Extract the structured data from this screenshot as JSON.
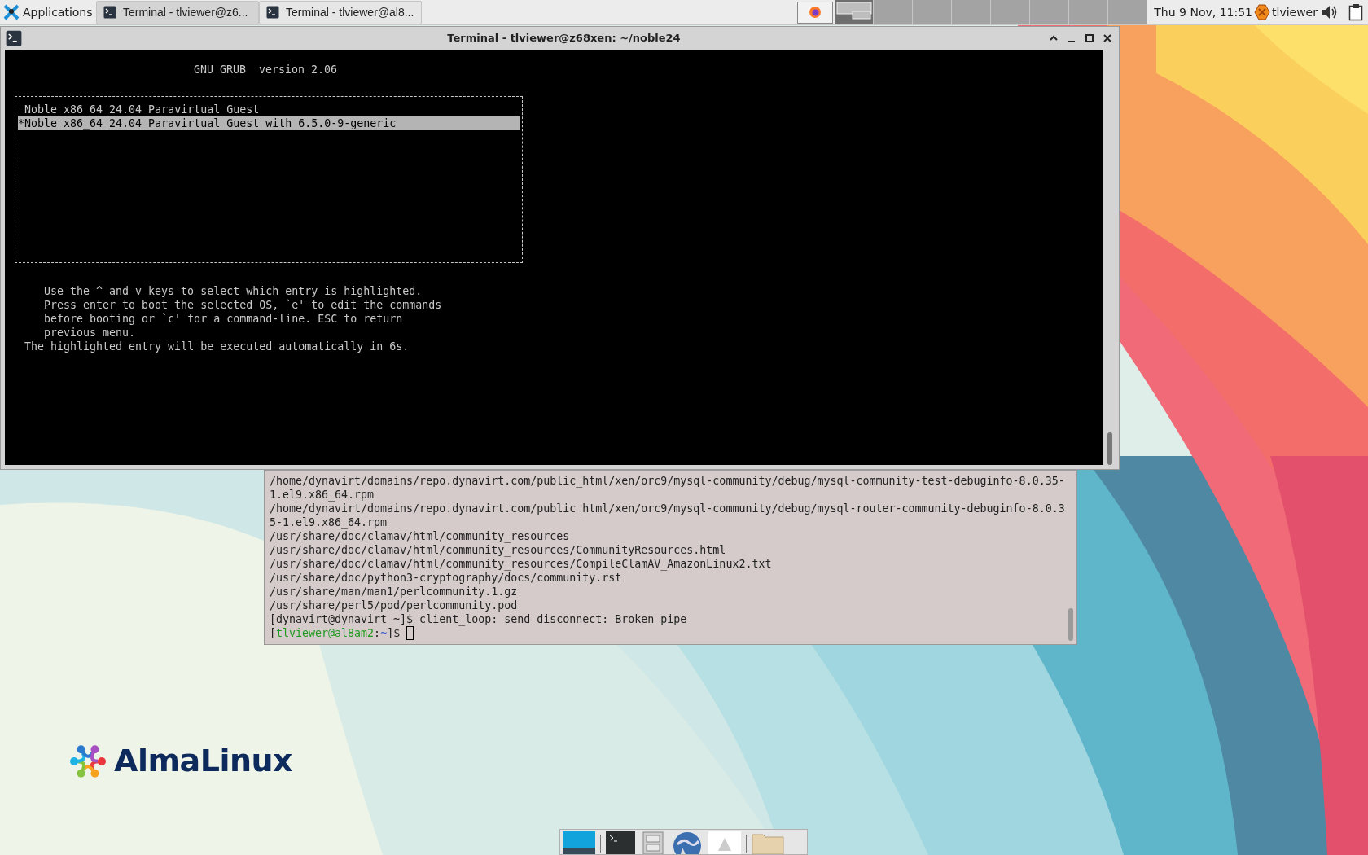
{
  "panel": {
    "menu_label": "Applications",
    "tasks": [
      {
        "label": "Terminal - tlviewer@z6...",
        "selected": true
      },
      {
        "label": "Terminal - tlviewer@al8...",
        "selected": false
      }
    ],
    "workspaces": [
      {
        "selected": true
      },
      {
        "selected": false
      },
      {
        "selected": false
      },
      {
        "selected": false
      },
      {
        "selected": false
      },
      {
        "selected": false
      },
      {
        "selected": false
      },
      {
        "selected": false
      }
    ],
    "clock": "Thu  9 Nov, 11:51",
    "user": "tlviewer"
  },
  "front_window": {
    "title": "Terminal - tlviewer@z68xen: ~/noble24",
    "grub": {
      "title": "GNU GRUB  version 2.06",
      "entries": [
        {
          "label": " Noble x86_64 24.04 Paravirtual Guest",
          "selected": false
        },
        {
          "label": "*Noble x86_64 24.04 Paravirtual Guest with 6.5.0-9-generic",
          "selected": true
        }
      ],
      "help": [
        "Use the ^ and v keys to select which entry is highlighted.",
        "Press enter to boot the selected OS, `e' to edit the commands",
        "before booting or `c' for a command-line. ESC to return",
        "previous menu."
      ],
      "countdown": "The highlighted entry will be executed automatically in 6s."
    }
  },
  "back_window": {
    "lines": [
      "/home/dynavirt/domains/repo.dynavirt.com/public_html/xen/orc9/mysql-community/debug/mysql-community-test-debuginfo-8.0.35-",
      "1.el9.x86_64.rpm",
      "/home/dynavirt/domains/repo.dynavirt.com/public_html/xen/orc9/mysql-community/debug/mysql-router-community-debuginfo-8.0.3",
      "5-1.el9.x86_64.rpm",
      "/usr/share/doc/clamav/html/community_resources",
      "/usr/share/doc/clamav/html/community_resources/CommunityResources.html",
      "/usr/share/doc/clamav/html/community_resources/CompileClamAV_AmazonLinux2.txt",
      "/usr/share/doc/python3-cryptography/docs/community.rst",
      "/usr/share/man/man1/perlcommunity.1.gz",
      "/usr/share/perl5/pod/perlcommunity.pod",
      "[dynavirt@dynavirt ~]$ client_loop: send disconnect: Broken pipe"
    ],
    "prompt": [
      {
        "kind": "plain",
        "text": "["
      },
      {
        "kind": "user",
        "text": "tlviewer@al8am2"
      },
      {
        "kind": "plain",
        "text": ":"
      },
      {
        "kind": "path",
        "text": "~"
      },
      {
        "kind": "plain",
        "text": "]$ "
      }
    ]
  },
  "desktop_logo": "AlmaLinux"
}
